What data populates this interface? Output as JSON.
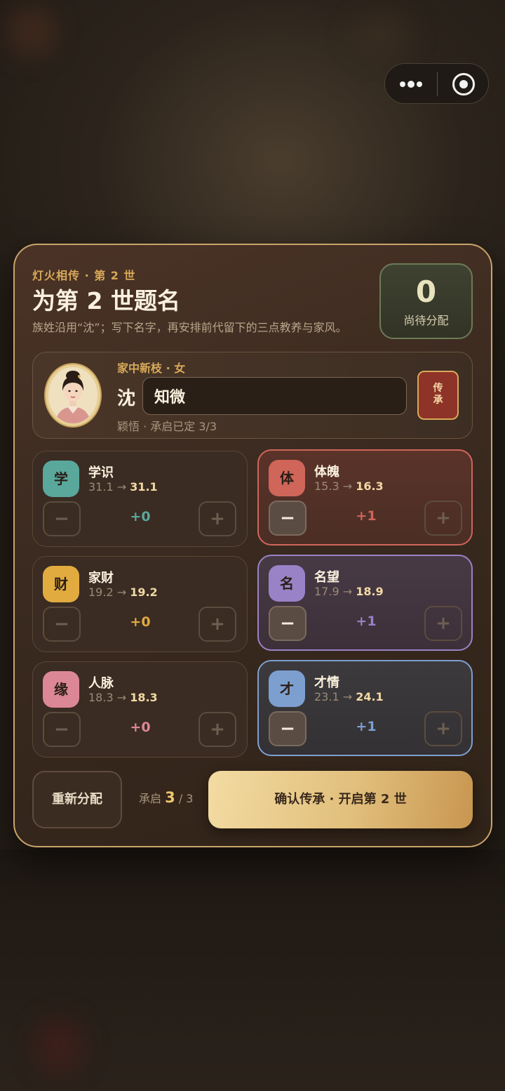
{
  "capsule": {
    "menu_icon": "more-dots-icon",
    "close_icon": "target-circle-icon"
  },
  "header": {
    "eyebrow": "灯火相传 · 第 2 世",
    "title": "为第 2 世题名",
    "subtitle": "族姓沿用“沈”；写下名字，再安排前代留下的三点教养与家风。"
  },
  "pending": {
    "value": "0",
    "label": "尚待分配"
  },
  "heir": {
    "tag": "家中新枝 · 女",
    "surname": "沈",
    "given_name": "知微",
    "note": "颖悟 · 承启已定 3/3",
    "inherit_label": "传承"
  },
  "stats": [
    {
      "badge": "学",
      "name": "学识",
      "from": "31.1",
      "to": "31.1",
      "delta": "+0",
      "color": "#5aa79c"
    },
    {
      "badge": "体",
      "name": "体魄",
      "from": "15.3",
      "to": "16.3",
      "delta": "+1",
      "color": "#d0655a"
    },
    {
      "badge": "财",
      "name": "家财",
      "from": "19.2",
      "to": "19.2",
      "delta": "+0",
      "color": "#e2ab40"
    },
    {
      "badge": "名",
      "name": "名望",
      "from": "17.9",
      "to": "18.9",
      "delta": "+1",
      "color": "#9a82c6"
    },
    {
      "badge": "缘",
      "name": "人脉",
      "from": "18.3",
      "to": "18.3",
      "delta": "+0",
      "color": "#dc8795"
    },
    {
      "badge": "才",
      "name": "才情",
      "from": "23.1",
      "to": "24.1",
      "delta": "+1",
      "color": "#7d9fd0"
    }
  ],
  "stat_button_minus": "−",
  "stat_button_plus": "+",
  "arrow": "→",
  "footer": {
    "reset_label": "重新分配",
    "count_prefix": "承启",
    "count_value": "3",
    "count_total": "/ 3",
    "confirm_label": "确认传承 · 开启第 2 世"
  }
}
